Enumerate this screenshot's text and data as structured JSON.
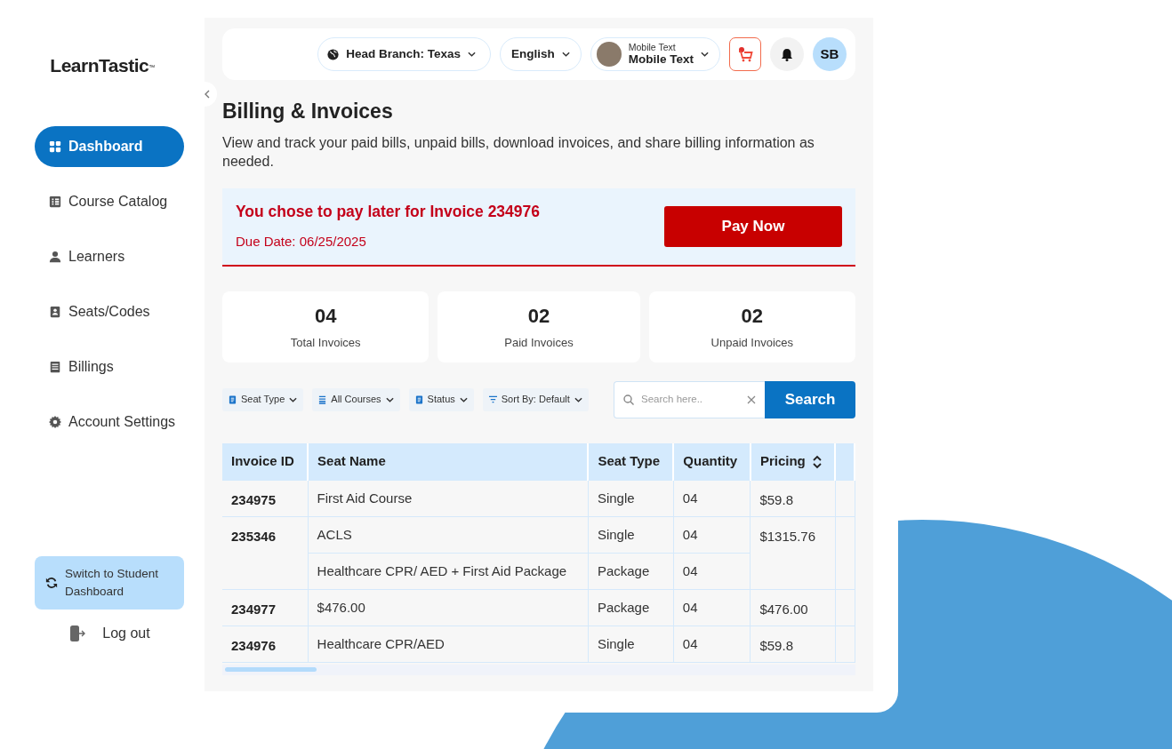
{
  "sidebar": {
    "logo": "LearnTastic",
    "logo_mark": "™",
    "items": [
      {
        "label": "Dashboard",
        "selected": true
      },
      {
        "label": "Course Catalog",
        "selected": false
      },
      {
        "label": "Learners",
        "selected": false
      },
      {
        "label": "Seats/Codes",
        "selected": false
      },
      {
        "label": "Billings",
        "selected": false
      },
      {
        "label": "Account Settings",
        "selected": false
      }
    ],
    "switch_button": "Switch to Student Dashboard",
    "logout": "Log out"
  },
  "topbar": {
    "branch": "Head Branch: Texas",
    "language": "English",
    "user_caption": "Mobile Text",
    "user_name": "Mobile Text",
    "avatar_initials": "SB"
  },
  "page": {
    "title": "Billing & Invoices",
    "description": "View and track your paid bills, unpaid bills, download invoices, and share billing information as needed."
  },
  "alert": {
    "message": "You chose to pay later for Invoice 234976",
    "due_date": "Due Date: 06/25/2025",
    "button": "Pay Now"
  },
  "stats": [
    {
      "value": "04",
      "label": "Total Invoices"
    },
    {
      "value": "02",
      "label": "Paid Invoices"
    },
    {
      "value": "02",
      "label": "Unpaid Invoices"
    }
  ],
  "filters": [
    "Seat Type",
    "All Courses",
    "Status",
    "Sort By: Default"
  ],
  "search": {
    "placeholder": "Search here..",
    "button": "Search"
  },
  "table": {
    "columns": [
      {
        "label": "Invoice ID",
        "sortable": false
      },
      {
        "label": "Seat Name",
        "sortable": false
      },
      {
        "label": "Seat Type",
        "sortable": false
      },
      {
        "label": "Quantity",
        "sortable": false
      },
      {
        "label": "Pricing",
        "sortable": true
      }
    ],
    "invoices": [
      {
        "id": "234975",
        "price": "$59.8",
        "items": [
          {
            "seat_name": "First Aid Course",
            "seat_type": "Single",
            "quantity": "04"
          }
        ]
      },
      {
        "id": "235346",
        "price": "$1315.76",
        "items": [
          {
            "seat_name": "ACLS",
            "seat_type": "Single",
            "quantity": "04"
          },
          {
            "seat_name": "Healthcare CPR/ AED + First Aid Package",
            "seat_type": "Package",
            "quantity": "04"
          }
        ]
      },
      {
        "id": "234977",
        "price": "$476.00",
        "items": [
          {
            "seat_name": "$476.00",
            "seat_type": "Package",
            "quantity": "04"
          }
        ]
      },
      {
        "id": "234976",
        "price": "$59.8",
        "items": [
          {
            "seat_name": "Healthcare CPR/AED",
            "seat_type": "Single",
            "quantity": "04"
          }
        ]
      }
    ]
  }
}
